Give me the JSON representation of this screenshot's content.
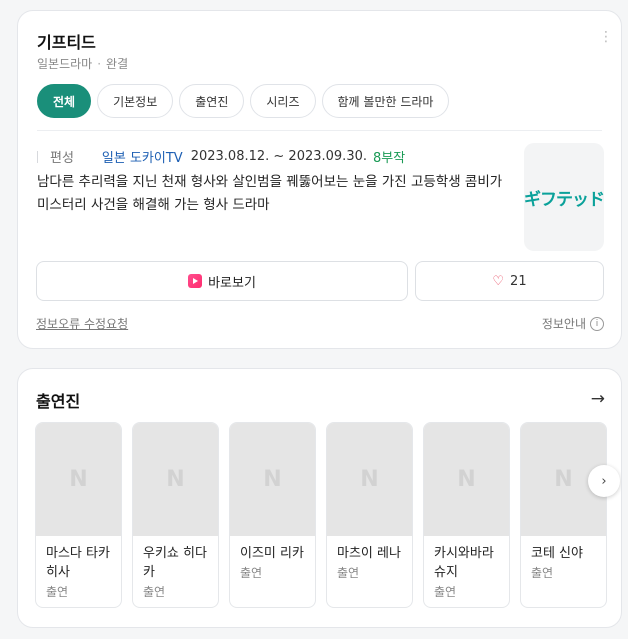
{
  "info": {
    "title": "기프티드",
    "genre": "일본드라마",
    "status": "완결",
    "more_icon": "more-vertical-icon",
    "tabs": [
      {
        "label": "전체",
        "active": true
      },
      {
        "label": "기본정보",
        "active": false
      },
      {
        "label": "출연진",
        "active": false
      },
      {
        "label": "시리즈",
        "active": false
      },
      {
        "label": "함께 볼만한 드라마",
        "active": false
      }
    ],
    "meta_label": "편성",
    "broadcaster": "일본 도카이TV",
    "period": "2023.08.12. ~ 2023.09.30.",
    "episodes": "8부작",
    "description": "남다른 추리력을 지닌 천재 형사와 살인범을 꿰뚫어보는 눈을 가진 고등학생 콤비가 미스터리 사건을 해결해 가는 형사 드라마",
    "poster_text": "ギフテッド",
    "watch_label": "바로보기",
    "like_count": "21",
    "report_label": "정보오류 수정요청",
    "guide_label": "정보안내",
    "accent_color": "#1a8f7a"
  },
  "cast": {
    "title": "출연진",
    "placeholder_letter": "N",
    "items": [
      {
        "name": "마스다 타카히사",
        "role": "출연"
      },
      {
        "name": "우키쇼 히다카",
        "role": "출연"
      },
      {
        "name": "이즈미 리카",
        "role": "출연"
      },
      {
        "name": "마츠이 레나",
        "role": "출연"
      },
      {
        "name": "카시와바라 슈지",
        "role": "출연"
      },
      {
        "name": "코테 신야",
        "role": "출연"
      }
    ]
  }
}
